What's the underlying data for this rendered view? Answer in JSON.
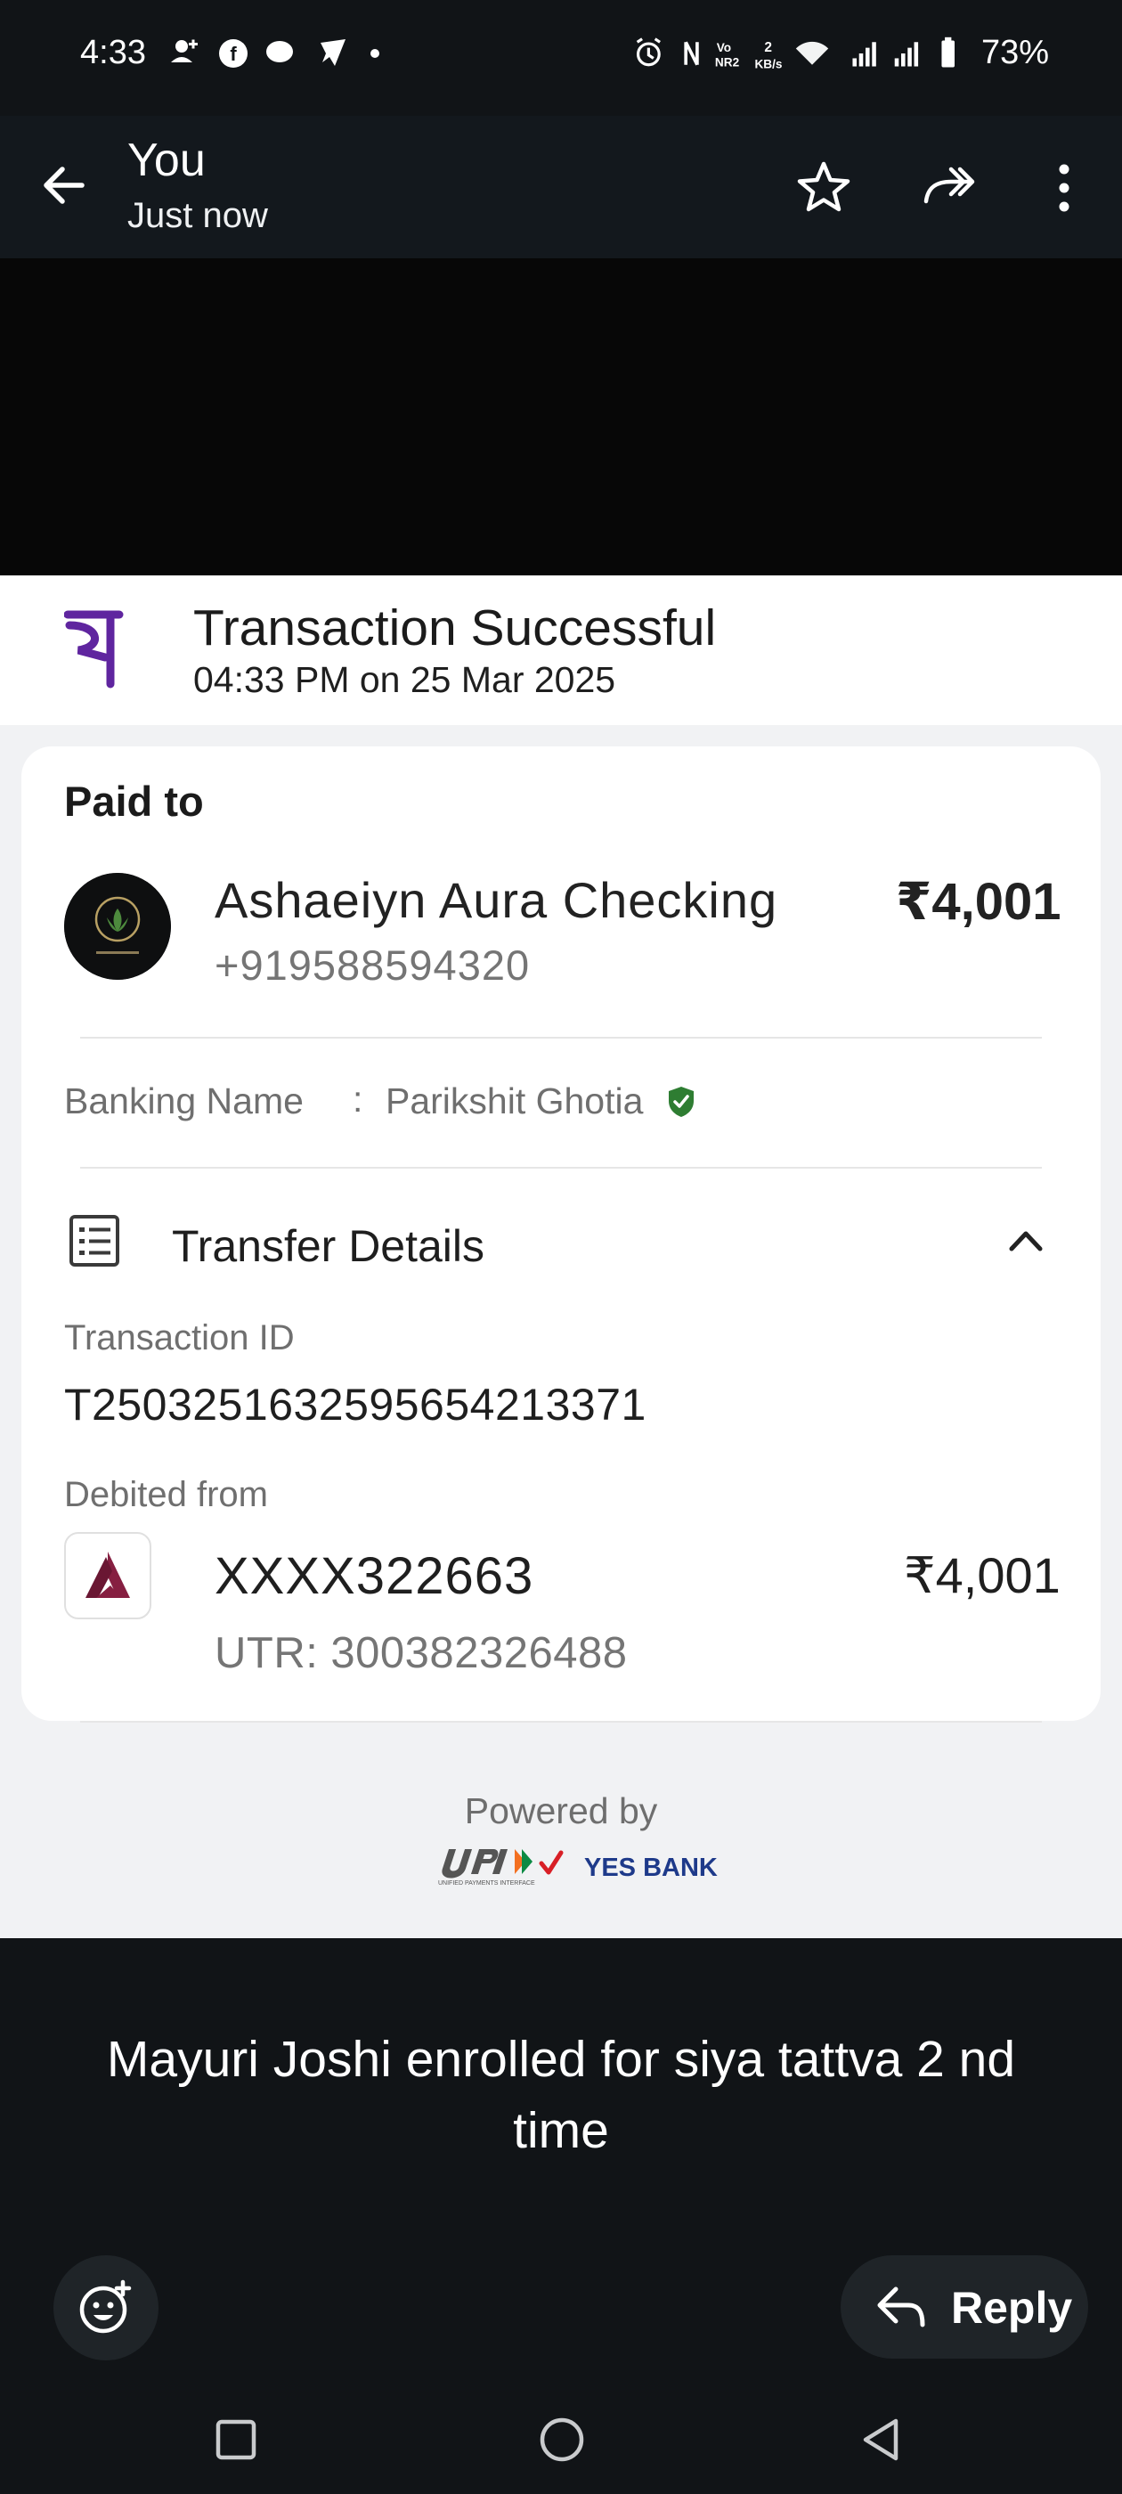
{
  "status_bar": {
    "time": "4:33",
    "battery": "73%",
    "network_speed": "2 KB/s"
  },
  "header": {
    "sender": "You",
    "timestamp": "Just now",
    "icons": [
      "back-arrow-icon",
      "star-icon",
      "forward-icon",
      "more-icon"
    ]
  },
  "transaction": {
    "status": "Transaction Successful",
    "datetime": "04:33 PM on 25 Mar 2025",
    "paid_to_label": "Paid to",
    "payee_name": "Ashaeiyn Aura Checking",
    "payee_phone": "+919588594320",
    "amount": "₹4,001",
    "banking_name_label": "Banking Name",
    "banking_name_sep": ":",
    "banking_name": "Parikshit Ghotia",
    "transfer_details_label": "Transfer Details",
    "transaction_id_label": "Transaction ID",
    "transaction_id": "T2503251632595654213371",
    "debited_from_label": "Debited from",
    "account_number": "XXXX322663",
    "debited_amount": "₹4,001",
    "utr": "UTR: 300382326488",
    "powered_by_label": "Powered by",
    "bank_partner": "YES BANK"
  },
  "message": {
    "caption": "Mayuri  Joshi enrolled for siya tattva 2 nd time"
  },
  "actions": {
    "reply_label": "Reply"
  },
  "colors": {
    "phonepe_purple": "#5f259f",
    "verified_green": "#2e7d32",
    "axis_maroon": "#861f41",
    "dark_bg": "#111417"
  }
}
